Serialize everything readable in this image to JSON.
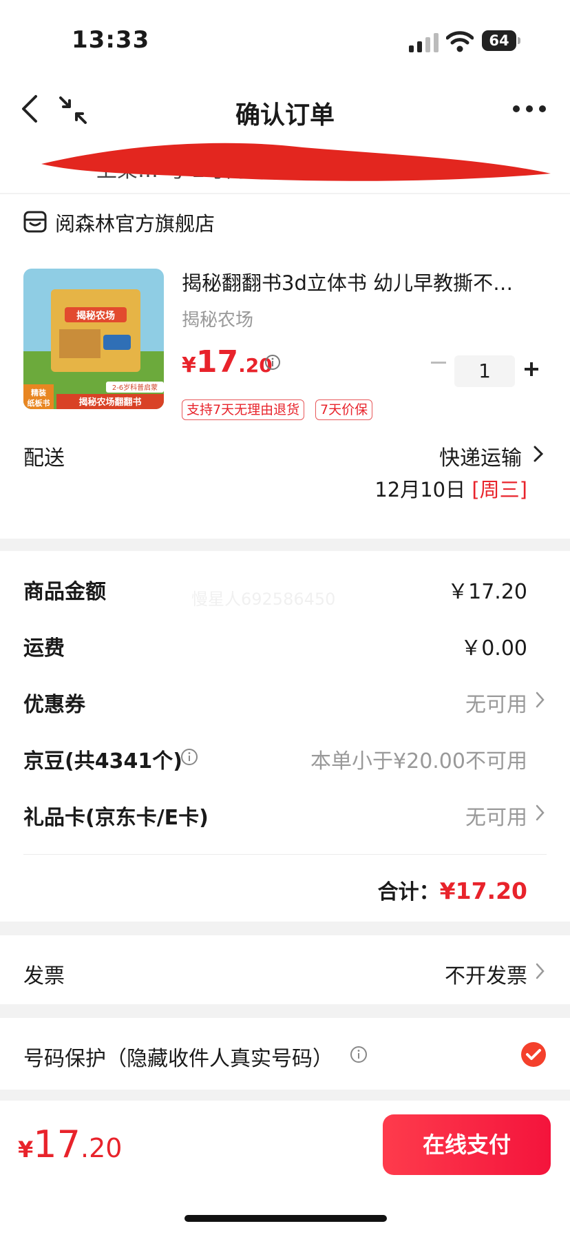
{
  "status_bar": {
    "time": "13:33",
    "battery": "64"
  },
  "header": {
    "title": "确认订单",
    "address_partial": "上架…          号 2号门"
  },
  "store": {
    "name": "阅森林官方旗舰店"
  },
  "product": {
    "title": "揭秘翻翻书3d立体书 幼儿早教撕不…",
    "spec": "揭秘农场",
    "price_symbol": "¥",
    "price_int": "17",
    "price_dec": ".20",
    "quantity": "1",
    "tags": [
      "支持7天无理由退货",
      "7天价保"
    ],
    "image_texts": {
      "banner": "揭秘农场",
      "badge": "精装\n纸板书",
      "age": "2-6岁科普启蒙",
      "caption": "揭秘农场翻翻书"
    }
  },
  "delivery": {
    "label": "配送",
    "method": "快递运输",
    "date": "12月10日",
    "weekday": "[周三]"
  },
  "price_rows": [
    {
      "label": "商品金额",
      "value": "￥17.20"
    },
    {
      "label": "运费",
      "value": "￥0.00"
    },
    {
      "label": "优惠券",
      "value": "无可用"
    },
    {
      "label": "京豆(共4341个)",
      "value": "本单小于¥20.00不可用"
    },
    {
      "label": "礼品卡(京东卡/E卡)",
      "value": "无可用"
    }
  ],
  "watermark": "慢星人692586450",
  "total": {
    "label": "合计：",
    "amount": "¥17.20"
  },
  "invoice": {
    "label": "发票",
    "value": "不开发票"
  },
  "privacy": {
    "label": "号码保护（隐藏收件人真实号码）",
    "checked": true
  },
  "bottom": {
    "symbol": "¥",
    "int": "17",
    "dec": ".20",
    "pay_label": "在线支付"
  },
  "colors": {
    "accent": "#e8232b",
    "pay_button": "#f4143c"
  }
}
